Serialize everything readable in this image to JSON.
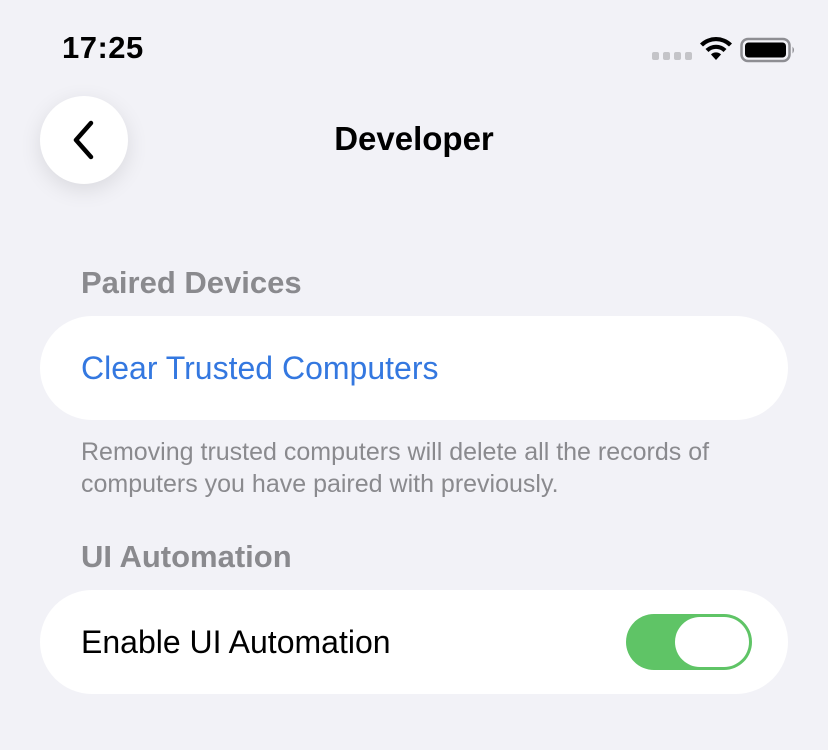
{
  "status_bar": {
    "time": "17:25",
    "icons": [
      "cellular-signal-icon",
      "wifi-icon",
      "battery-icon"
    ]
  },
  "nav": {
    "title": "Developer",
    "back_icon": "chevron-left-icon"
  },
  "sections": {
    "paired_devices": {
      "header": "Paired Devices",
      "action_label": "Clear Trusted Computers",
      "footer": "Removing trusted computers will delete all the records of computers you have paired with previously."
    },
    "ui_automation": {
      "header": "UI Automation",
      "row_label": "Enable UI Automation",
      "toggle_on": true
    }
  },
  "colors": {
    "background": "#f2f2f7",
    "accent_link": "#3478e0",
    "toggle_on": "#5fc466",
    "secondary_text": "#8a8a8e"
  }
}
